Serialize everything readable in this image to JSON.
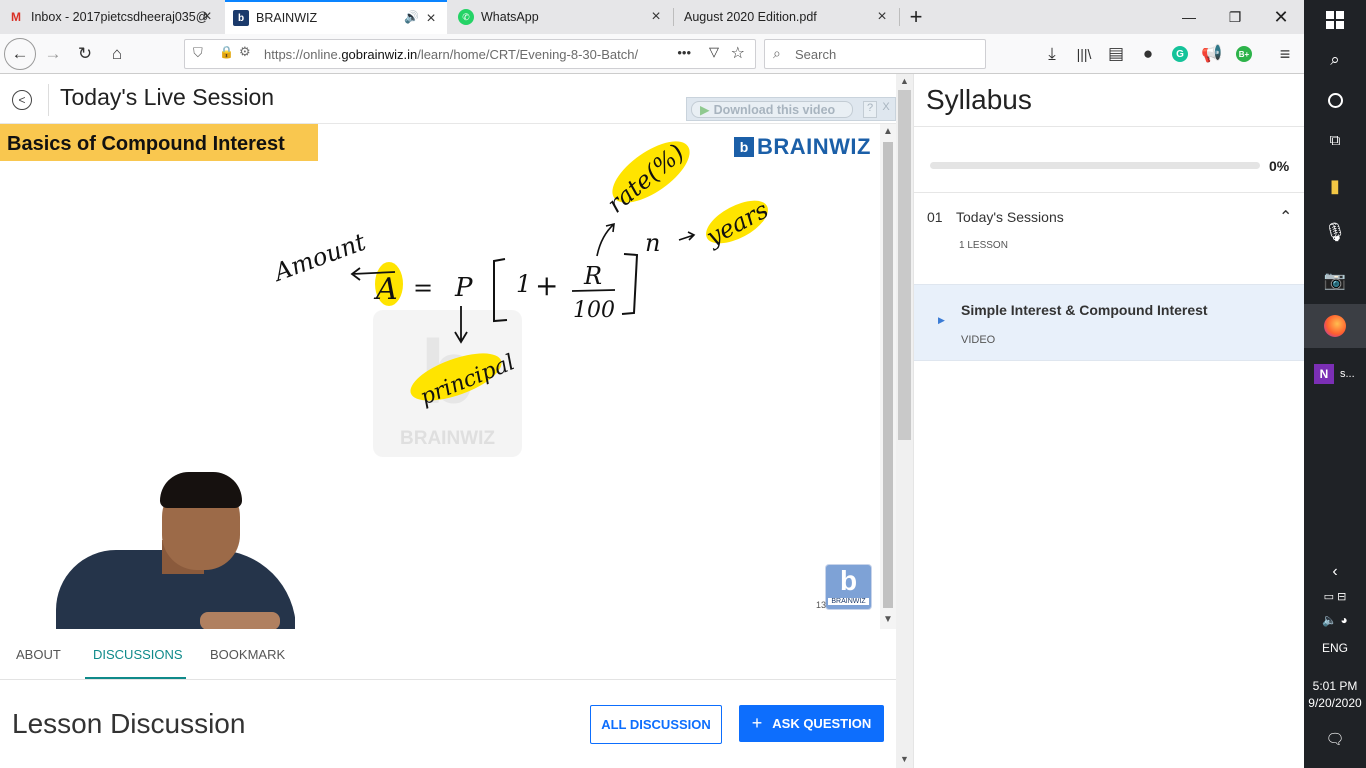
{
  "browser": {
    "tabs": [
      {
        "title": "Inbox - 2017pietcsdheeraj035@",
        "icon": "gmail-icon"
      },
      {
        "title": "BRAINWIZ",
        "icon": "brainwiz-icon"
      },
      {
        "title": "WhatsApp",
        "icon": "whatsapp-icon"
      },
      {
        "title": "August 2020 Edition.pdf",
        "icon": "pdf-icon"
      }
    ],
    "url_prefix": "https://online.",
    "url_domain": "gobrainwiz.in",
    "url_path": "/learn/home/CRT/Evening-8-30-Batch/",
    "search_placeholder": "Search"
  },
  "session": {
    "title": "Today's Live Session",
    "download_label": "Download this video",
    "help": "?",
    "close": "X"
  },
  "video": {
    "banner_title": "Basics of Compound Interest",
    "logo_text": "BRAINWIZ",
    "watermark_text": "BRAINWIZ",
    "corner_logo_text": "BRAINWIZ",
    "corner_number": "13",
    "whiteboard": {
      "amount": "Amount",
      "formula_lhs": "A",
      "equals": "=",
      "p": "P",
      "one": "1",
      "plus": "+",
      "numerator": "R",
      "denominator": "100",
      "exponent": "n",
      "rate": "rate(%)",
      "years": "years",
      "principal": "principal"
    }
  },
  "content_tabs": [
    {
      "label": "ABOUT",
      "active": false
    },
    {
      "label": "DISCUSSIONS",
      "active": true
    },
    {
      "label": "BOOKMARK",
      "active": false
    }
  ],
  "discussion": {
    "heading": "Lesson Discussion",
    "all_button": "ALL DISCUSSION",
    "ask_button": "ASK QUESTION",
    "ask_icon": "+"
  },
  "syllabus": {
    "title": "Syllabus",
    "progress": "0%",
    "progress_value": 0,
    "sections": [
      {
        "number": "01",
        "title": "Today's Sessions",
        "meta": "1 LESSON"
      }
    ],
    "lessons": [
      {
        "title": "Simple Interest & Compound Interest",
        "type": "VIDEO"
      }
    ]
  },
  "taskbar": {
    "app_label": "s...",
    "lang": "ENG",
    "time": "5:01 PM",
    "date": "9/20/2020"
  },
  "colors": {
    "accent_blue": "#0a84ff",
    "teal": "#0f8a8a",
    "highlight_yellow": "#ffe400",
    "banner_yellow": "#f9c74f",
    "ask_button_blue": "#0d6efd",
    "brand_blue": "#1b5fa8"
  }
}
